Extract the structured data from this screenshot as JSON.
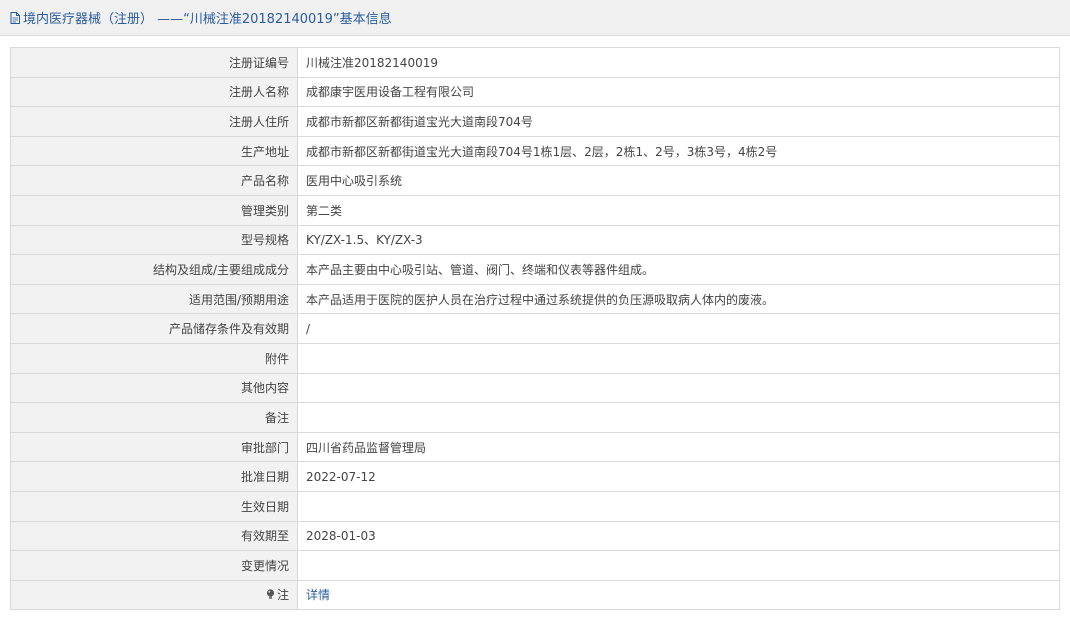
{
  "header": {
    "title": "境内医疗器械（注册） ——“川械注准20182140019”基本信息",
    "icon": "document-icon"
  },
  "rows": [
    {
      "label": "注册证编号",
      "value": "川械注准20182140019"
    },
    {
      "label": "注册人名称",
      "value": "成都康宇医用设备工程有限公司"
    },
    {
      "label": "注册人住所",
      "value": "成都市新都区新都街道宝光大道南段704号"
    },
    {
      "label": "生产地址",
      "value": "成都市新都区新都街道宝光大道南段704号1栋1层、2层，2栋1、2号，3栋3号，4栋2号"
    },
    {
      "label": "产品名称",
      "value": "医用中心吸引系统"
    },
    {
      "label": "管理类别",
      "value": "第二类"
    },
    {
      "label": "型号规格",
      "value": "KY/ZX-1.5、KY/ZX-3"
    },
    {
      "label": "结构及组成/主要组成成分",
      "value": "本产品主要由中心吸引站、管道、阀门、终端和仪表等器件组成。"
    },
    {
      "label": "适用范围/预期用途",
      "value": "本产品适用于医院的医护人员在治疗过程中通过系统提供的负压源吸取病人体内的废液。"
    },
    {
      "label": "产品储存条件及有效期",
      "value": "/"
    },
    {
      "label": "附件",
      "value": ""
    },
    {
      "label": "其他内容",
      "value": ""
    },
    {
      "label": "备注",
      "value": ""
    },
    {
      "label": "审批部门",
      "value": "四川省药品监督管理局"
    },
    {
      "label": "批准日期",
      "value": "2022-07-12"
    },
    {
      "label": "生效日期",
      "value": ""
    },
    {
      "label": "有效期至",
      "value": "2028-01-03"
    },
    {
      "label": "变更情况",
      "value": ""
    }
  ],
  "note": {
    "label": "注",
    "icon": "lightbulb-icon",
    "link_text": "详情"
  },
  "colors": {
    "title_text": "#2a5d9e",
    "label_bg": "#f2f2f2",
    "border": "#d9d9d9",
    "link": "#2a5d9e"
  }
}
